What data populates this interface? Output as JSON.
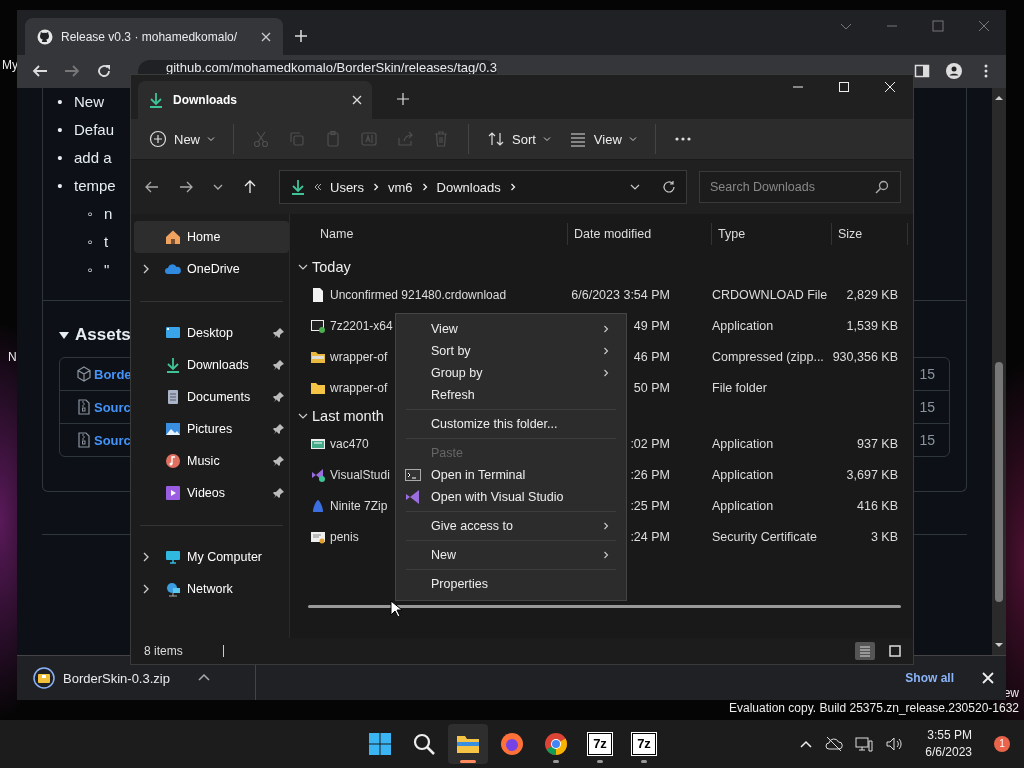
{
  "desktop": {
    "icon_labels": [
      "My",
      "N"
    ],
    "notice": [
      "ew",
      "Evaluation copy. Build 25375.zn_release.230520-1632"
    ]
  },
  "browser": {
    "tab_title": "Release v0.3 · mohamedkomalo/",
    "url": "github.com/mohamedkomalo/BorderSkin/releases/tag/0.3",
    "bullets": [
      {
        "marker": "•",
        "text": "New"
      },
      {
        "marker": "•",
        "text": "Defau"
      },
      {
        "marker": "•",
        "text": "add a"
      },
      {
        "marker": "•",
        "text": "tempe",
        "children": [
          {
            "marker": "◦",
            "text": "n"
          },
          {
            "marker": "◦",
            "text": "t"
          },
          {
            "marker": "◦",
            "text": "\""
          }
        ]
      }
    ],
    "assets": {
      "title": "Assets",
      "expanded": true,
      "rows": [
        {
          "kind": "package",
          "name": "Borde",
          "date": "15"
        },
        {
          "kind": "archive",
          "name": "Sourc",
          "date": "15"
        },
        {
          "kind": "archive",
          "name": "Sourc",
          "date": "15"
        }
      ]
    },
    "download": {
      "file": "BorderSkin-0.3.zip",
      "show_all": "Show all"
    }
  },
  "explorer": {
    "tab_title": "Downloads",
    "commands": [
      {
        "kind": "new",
        "label": "New",
        "disabled": false
      },
      {
        "kind": "cut",
        "disabled": true
      },
      {
        "kind": "copy",
        "disabled": true
      },
      {
        "kind": "paste",
        "disabled": true
      },
      {
        "kind": "rename",
        "disabled": true
      },
      {
        "kind": "share",
        "disabled": true
      },
      {
        "kind": "delete",
        "disabled": true
      },
      {
        "kind": "sort",
        "label": "Sort",
        "disabled": false
      },
      {
        "kind": "view",
        "label": "View",
        "disabled": false
      },
      {
        "kind": "more",
        "disabled": false
      }
    ],
    "breadcrumb": [
      "Users",
      "vm6",
      "Downloads"
    ],
    "search": {
      "placeholder": "Search Downloads"
    },
    "nav": [
      {
        "items": [
          {
            "kind": "home",
            "label": "Home",
            "selected": true,
            "pinned": false,
            "expandable": false
          },
          {
            "kind": "cloud",
            "label": "OneDrive",
            "selected": false,
            "pinned": false,
            "expandable": true
          }
        ]
      },
      {
        "items": [
          {
            "kind": "desktop",
            "label": "Desktop",
            "selected": false,
            "pinned": true,
            "expandable": false
          },
          {
            "kind": "downloads",
            "label": "Downloads",
            "selected": false,
            "pinned": true,
            "expandable": false
          },
          {
            "kind": "documents",
            "label": "Documents",
            "selected": false,
            "pinned": true,
            "expandable": false
          },
          {
            "kind": "pictures",
            "label": "Pictures",
            "selected": false,
            "pinned": true,
            "expandable": false
          },
          {
            "kind": "music",
            "label": "Music",
            "selected": false,
            "pinned": true,
            "expandable": false
          },
          {
            "kind": "videos",
            "label": "Videos",
            "selected": false,
            "pinned": true,
            "expandable": false
          }
        ]
      },
      {
        "items": [
          {
            "kind": "computer",
            "label": "My Computer",
            "selected": false,
            "pinned": false,
            "expandable": true
          },
          {
            "kind": "network",
            "label": "Network",
            "selected": false,
            "pinned": false,
            "expandable": true
          }
        ]
      }
    ],
    "columns": [
      "Name",
      "Date modified",
      "Type",
      "Size"
    ],
    "groups": [
      {
        "title": "Today",
        "expanded": true,
        "files": [
          {
            "kind": "document",
            "name": "Unconfirmed 921480.crdownload",
            "date": "6/6/2023 3:54 PM",
            "type": "CRDOWNLOAD File",
            "size": "2,829 KB"
          },
          {
            "kind": "installer",
            "name": "7z2201-x64",
            "date": "49 PM",
            "type": "Application",
            "size": "1,539 KB"
          },
          {
            "kind": "zip",
            "name": "wrapper-of",
            "date": "46 PM",
            "type": "Compressed (zipp...",
            "size": "930,356 KB"
          },
          {
            "kind": "folder",
            "name": "wrapper-of",
            "date": "50 PM",
            "type": "File folder"
          }
        ]
      },
      {
        "title": "Last month",
        "expanded": true,
        "files": [
          {
            "kind": "app",
            "name": "vac470",
            "date": ":02 PM",
            "type": "Application",
            "size": "937 KB"
          },
          {
            "kind": "vs",
            "name": "VisualStudi",
            "date": ":26 PM",
            "type": "Application",
            "size": "3,697 KB"
          },
          {
            "kind": "ninite",
            "name": "Ninite 7Zip",
            "date": ":25 PM",
            "type": "Application",
            "size": "416 KB"
          },
          {
            "kind": "certificate",
            "name": "penis",
            "date": ":24 PM",
            "type": "Security Certificate",
            "size": "3 KB"
          }
        ]
      }
    ],
    "status": "8 items",
    "views": [
      {
        "kind": "details",
        "selected": true
      },
      {
        "kind": "tiles",
        "selected": false
      }
    ]
  },
  "context_menu": [
    {
      "kind": "item",
      "label": "View",
      "submenu": true,
      "disabled": false
    },
    {
      "kind": "item",
      "label": "Sort by",
      "submenu": true,
      "disabled": false
    },
    {
      "kind": "item",
      "label": "Group by",
      "submenu": true,
      "disabled": false
    },
    {
      "kind": "item",
      "label": "Refresh",
      "submenu": false,
      "disabled": false
    },
    {
      "kind": "separator"
    },
    {
      "kind": "item",
      "label": "Customize this folder...",
      "submenu": false,
      "disabled": false
    },
    {
      "kind": "separator"
    },
    {
      "kind": "item",
      "label": "Paste",
      "submenu": false,
      "disabled": true
    },
    {
      "kind": "terminal",
      "label": "Open in Terminal",
      "submenu": false,
      "disabled": false
    },
    {
      "kind": "studio",
      "label": "Open with Visual Studio",
      "submenu": false,
      "disabled": false
    },
    {
      "kind": "separator"
    },
    {
      "kind": "item",
      "label": "Give access to",
      "submenu": true,
      "disabled": false
    },
    {
      "kind": "separator"
    },
    {
      "kind": "item",
      "label": "New",
      "submenu": true,
      "disabled": false
    },
    {
      "kind": "separator"
    },
    {
      "kind": "item",
      "label": "Properties",
      "submenu": false,
      "disabled": false
    }
  ],
  "taskbar": {
    "apps": [
      {
        "kind": "start",
        "active": false,
        "running": false
      },
      {
        "kind": "search",
        "active": false,
        "running": false
      },
      {
        "kind": "explorer",
        "active": true,
        "running": true
      },
      {
        "kind": "firefox",
        "active": false,
        "running": false
      },
      {
        "kind": "chrome",
        "active": false,
        "running": true
      },
      {
        "kind": "sevenzip",
        "label": "7z",
        "active": false,
        "running": true
      },
      {
        "kind": "sevenzip",
        "label": "7z",
        "active": false,
        "running": true
      }
    ],
    "time": "3:55 PM",
    "date": "6/6/2023",
    "notifications": "1"
  }
}
